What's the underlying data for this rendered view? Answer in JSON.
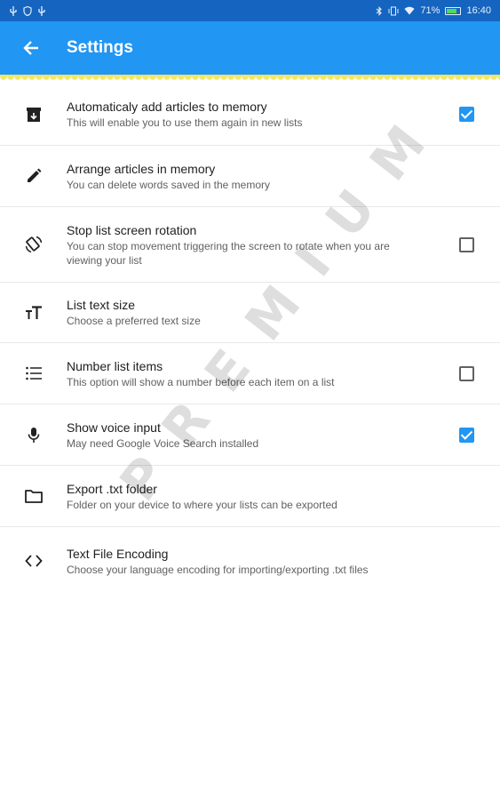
{
  "status_bar": {
    "left_icons": [
      "usb-icon",
      "shield-icon",
      "usb-icon"
    ],
    "battery_percent": "71%",
    "time": "16:40"
  },
  "app_bar": {
    "title": "Settings"
  },
  "settings": [
    {
      "title": "Automaticaly add articles to memory",
      "subtitle": "This will enable you to use them again in new lists",
      "icon": "archive-icon",
      "control": "checked"
    },
    {
      "title": "Arrange articles in memory",
      "subtitle": "You can delete words saved in the memory",
      "icon": "pencil-icon",
      "control": "none"
    },
    {
      "title": "Stop list screen rotation",
      "subtitle": "You can stop movement triggering the screen to rotate when you are viewing your list",
      "icon": "screen-rotation-icon",
      "control": "unchecked"
    },
    {
      "title": "List text size",
      "subtitle": "Choose a preferred text size",
      "icon": "text-size-icon",
      "control": "none"
    },
    {
      "title": "Number list items",
      "subtitle": "This option will show a number before each item on a list",
      "icon": "list-icon",
      "control": "unchecked"
    },
    {
      "title": "Show voice input",
      "subtitle": "May need Google Voice Search installed",
      "icon": "microphone-icon",
      "control": "checked"
    },
    {
      "title": "Export .txt folder",
      "subtitle": "Folder on your device to where your lists can be exported",
      "icon": "folder-icon",
      "control": "none"
    },
    {
      "title": "Text File Encoding",
      "subtitle": "Choose your language encoding for importing/exporting .txt files",
      "icon": "code-icon",
      "control": "none"
    }
  ],
  "watermark": "PREMIUM",
  "colors": {
    "status_bar": "#1565c0",
    "app_bar": "#2196f3",
    "accent": "#2196f3",
    "scallop": "#f5e663"
  }
}
